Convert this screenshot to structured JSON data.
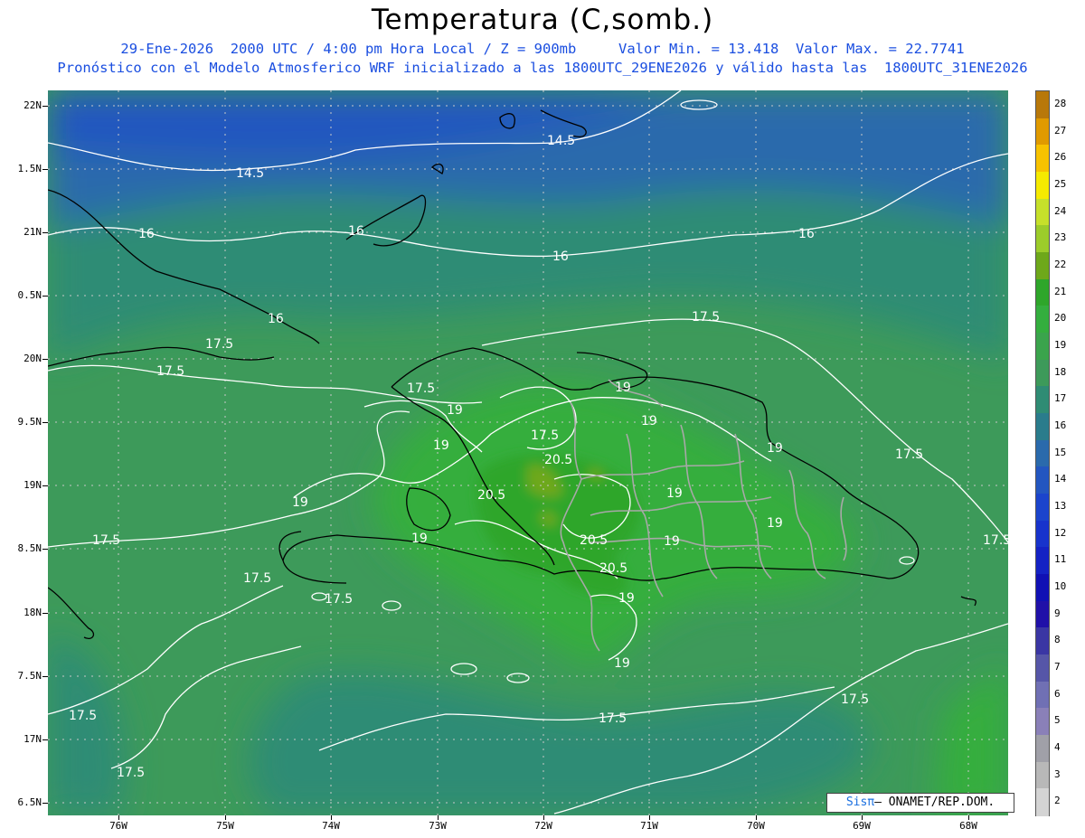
{
  "header": {
    "title": "Temperatura (C,somb.)",
    "line1": "29-Ene-2026  2000 UTC / 4:00 pm Hora Local / Z = 900mb     Valor Min. = 13.418  Valor Max. = 22.7741",
    "line2": "Pronóstico con el Modelo Atmosferico WRF inicializado a las 1800UTC_29ENE2026 y válido hasta las  1800UTC_31ENE2026"
  },
  "axes": {
    "lat_labels": [
      "22N",
      "1.5N",
      "21N",
      "0.5N",
      "20N",
      "9.5N",
      "19N",
      "8.5N",
      "18N",
      "7.5N",
      "17N",
      "6.5N"
    ],
    "lon_labels": [
      "76W",
      "75W",
      "74W",
      "73W",
      "72W",
      "71W",
      "70W",
      "69W",
      "68W"
    ]
  },
  "contour_labels": [
    "14.5",
    "14.5",
    "16",
    "16",
    "16",
    "16",
    "16",
    "17.5",
    "17.5",
    "17.5",
    "17.5",
    "17.5",
    "17.5",
    "17.5",
    "17.5",
    "17.5",
    "17.5",
    "17.5",
    "17.5",
    "17.5",
    "17.5",
    "19",
    "19",
    "19",
    "19",
    "19",
    "19",
    "19",
    "19",
    "19",
    "19",
    "19",
    "19",
    "20.5",
    "20.5",
    "20.5",
    "20.5"
  ],
  "colorbar": {
    "levels": [
      "28",
      "27",
      "26",
      "25",
      "24",
      "23",
      "22",
      "21",
      "20",
      "19",
      "18",
      "17",
      "16",
      "15",
      "14",
      "13",
      "12",
      "11",
      "10",
      "9",
      "8",
      "7",
      "6",
      "5",
      "4",
      "3",
      "2"
    ],
    "colors": [
      "#b8780a",
      "#e09a00",
      "#f7c200",
      "#f5ea00",
      "#c6e02a",
      "#9ccc2a",
      "#6ea81a",
      "#2ea62a",
      "#34ae3e",
      "#3aa44c",
      "#3d9a5a",
      "#2f8c74",
      "#2a7c8c",
      "#2a6aac",
      "#2356c0",
      "#1b44cc",
      "#1733cc",
      "#1422c4",
      "#1010b4",
      "#2010a8",
      "#3a36a4",
      "#5656a8",
      "#7070b4",
      "#8a80b8",
      "#a0a0a8",
      "#b8b8b8",
      "#d4d4d4"
    ]
  },
  "credit": {
    "brand": "Sisπ",
    "text": "– ONAMET/REP.DOM."
  }
}
